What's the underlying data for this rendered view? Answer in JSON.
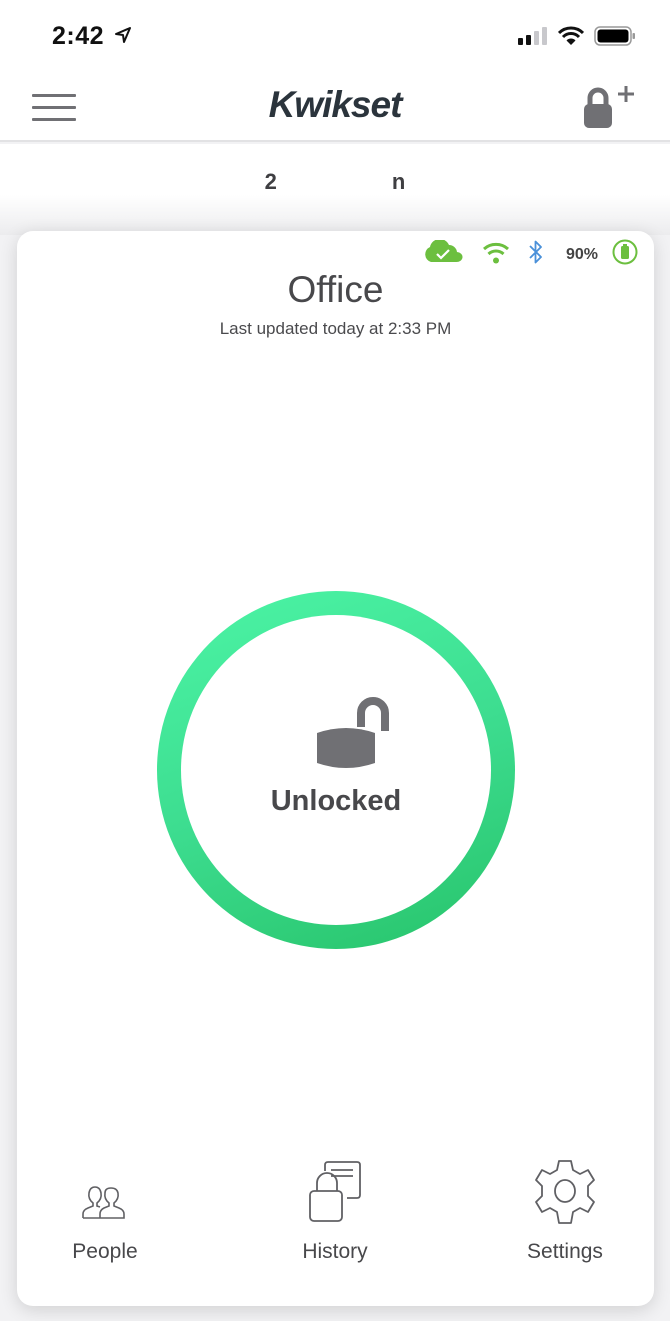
{
  "status_bar": {
    "time": "2:42",
    "icons": [
      "location-arrow-icon",
      "cellular-signal-icon",
      "wifi-icon",
      "battery-icon"
    ]
  },
  "nav_bar": {
    "menu_icon": "hamburger-menu-icon",
    "logo_text": "Kwikset",
    "add_lock_icon": "add-lock-icon"
  },
  "subtitle": {
    "left_fragment": "2",
    "right_fragment": "n"
  },
  "lock_card": {
    "status_icons": {
      "cloud": "cloud-check-icon",
      "wifi": "wifi-icon",
      "bluetooth": "bluetooth-icon",
      "battery": "battery-icon"
    },
    "battery_percent": "90%",
    "lock_name": "Office",
    "last_updated": "Last updated today at 2:33 PM",
    "lock_state": "Unlocked",
    "colors": {
      "ring_start": "#4cf5a6",
      "ring_end": "#27c36a",
      "status_green": "#6cbf3f",
      "bluetooth_blue": "#4a90d9"
    }
  },
  "bottom_nav": {
    "items": [
      {
        "label": "People",
        "icon": "people-icon"
      },
      {
        "label": "History",
        "icon": "history-icon"
      },
      {
        "label": "Settings",
        "icon": "gear-icon"
      }
    ]
  }
}
